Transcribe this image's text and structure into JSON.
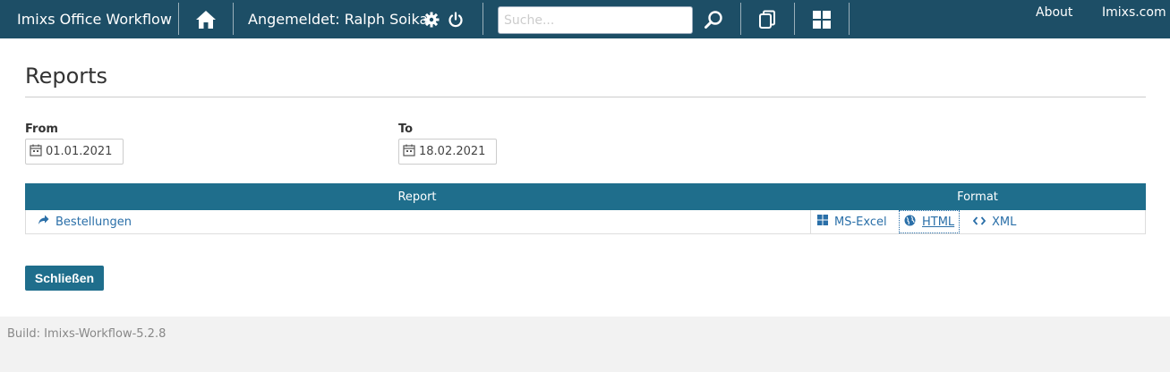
{
  "topbar": {
    "brand": "Imixs Office Workflow",
    "user_label": "Angemeldet: Ralph Soika",
    "search_placeholder": "Suche...",
    "about": "About",
    "site_link": "Imixs.com",
    "icons": [
      "home-icon",
      "gear-icon",
      "power-icon",
      "search-icon",
      "copy-icon",
      "windows-icon"
    ]
  },
  "page": {
    "title": "Reports",
    "from_label": "From",
    "from_value": "01.01.2021",
    "to_label": "To",
    "to_value": "18.02.2021"
  },
  "table": {
    "headers": [
      "Report",
      "Format"
    ],
    "rows": [
      {
        "report": "Bestellungen",
        "formats": [
          "MS-Excel",
          "HTML",
          "XML"
        ]
      }
    ]
  },
  "actions": {
    "close_label": "Schließen"
  },
  "footer": {
    "build": "Build: Imixs-Workflow-5.2.8"
  },
  "colors": {
    "topbar": "#1d4e66",
    "accent": "#1f6e8c",
    "link": "#2a6fa8"
  }
}
